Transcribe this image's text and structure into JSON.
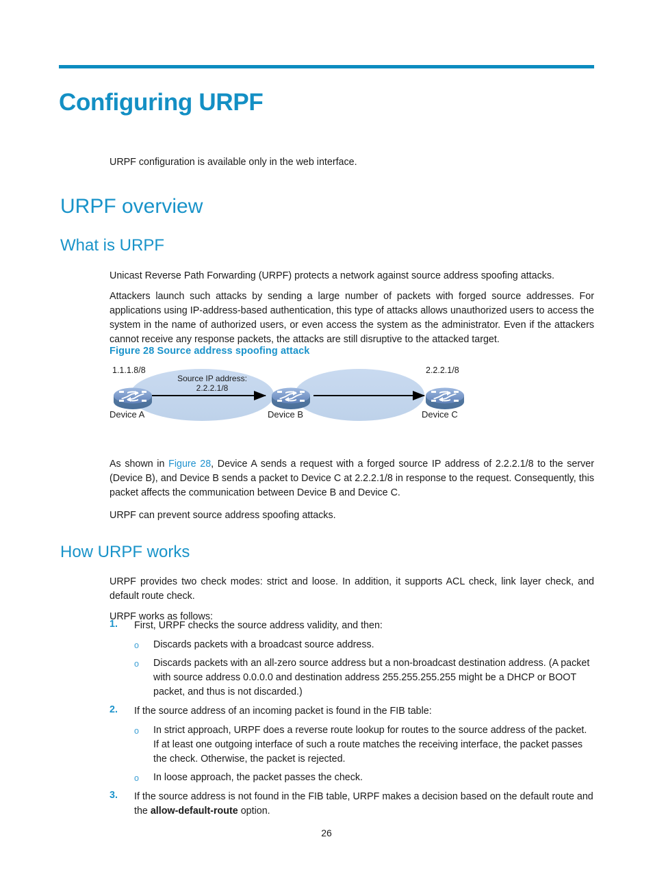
{
  "document": {
    "chapter_title": "Configuring URPF",
    "page_number": "26",
    "accent_color": "#0c8cc0",
    "heading_color": "#1993c9",
    "link_color": "#2092cf",
    "body_color": "#1a1a1a"
  },
  "intro": {
    "paragraph": "URPF configuration is available only in the web interface."
  },
  "overview": {
    "heading": "URPF overview",
    "what_is_urpf": {
      "heading": "What is URPF",
      "paragraph_1": "Unicast Reverse Path Forwarding (URPF) protects a network against source address spoofing attacks.",
      "paragraph_2": "Attackers launch such attacks by sending a large number of packets with forged source addresses. For applications using IP-address-based authentication, this type of attacks allows unauthorized users to access the system in the name of authorized users, or even access the system as the administrator. Even if the attackers cannot receive any response packets, the attacks are still disruptive to the attacked target.",
      "after_figure_prefix": "As shown in ",
      "after_figure_link": "Figure 28",
      "after_figure_suffix": ", Device A sends a request with a forged source IP address of 2.2.2.1/8 to the server (Device B), and Device B sends a packet to Device C at 2.2.2.1/8 in response to the request. Consequently, this packet affects the communication between Device B and Device C.",
      "paragraph_3": "URPF can prevent source address spoofing attacks."
    }
  },
  "figure": {
    "caption": "Figure 28 Source address spoofing attack",
    "cloud_color": "#c3d5ee",
    "router_body_color": "#5a7db5",
    "router_top_color": "#7f9fd0",
    "labels": {
      "device_a_address": "1.1.1.8/8",
      "device_a_name": "Device A",
      "device_b_name": "Device B",
      "device_c_address": "2.2.2.1/8",
      "device_c_name": "Device C",
      "link_label_line1": "Source IP address:",
      "link_label_line2": "2.2.2.1/8"
    }
  },
  "how_urpf_works": {
    "heading": "How URPF works",
    "paragraph_1": "URPF provides two check modes: strict and loose. In addition, it supports ACL check, link layer check, and default route check.",
    "paragraph_2": "URPF works as follows:",
    "steps": [
      {
        "number": "1.",
        "text": "First, URPF checks the source address validity, and then:",
        "sub_items": [
          "Discards packets with a broadcast source address.",
          "Discards packets with an all-zero source address but a non-broadcast destination address. (A packet with source address 0.0.0.0 and destination address 255.255.255.255 might be a DHCP or BOOT packet, and thus is not discarded.)"
        ]
      },
      {
        "number": "2.",
        "text": "If the source address of an incoming packet is found in the FIB table:",
        "sub_items": [
          "In strict approach, URPF does a reverse route lookup for routes to the source address of the packet. If at least one outgoing interface of such a route matches the receiving interface, the packet passes the check. Otherwise, the packet is rejected.",
          "In loose approach, the packet passes the check."
        ]
      },
      {
        "number": "3.",
        "text_prefix": "If the source address is not found in the FIB table, URPF makes a decision based on the default route and the ",
        "text_bold": "allow-default-route",
        "text_suffix": " option."
      }
    ]
  }
}
